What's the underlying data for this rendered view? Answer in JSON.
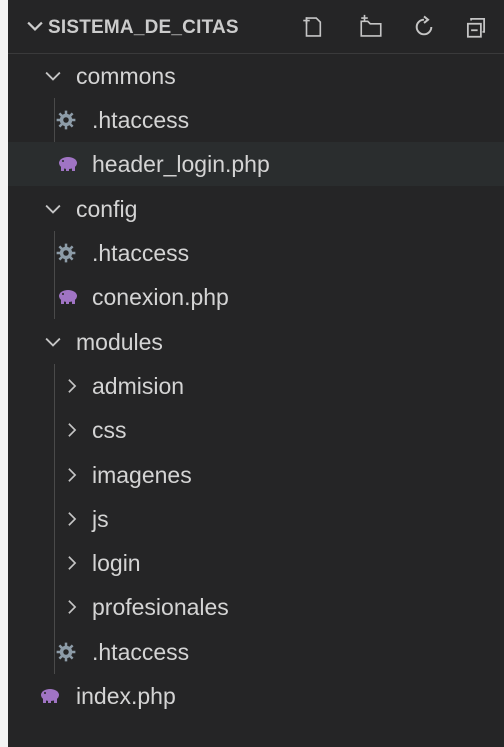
{
  "explorer": {
    "title": "SISTEMA_DE_CITAS",
    "header_icons": [
      "new-file-icon",
      "new-folder-icon",
      "refresh-icon",
      "collapse-all-icon"
    ],
    "tree": [
      {
        "label": "commons",
        "type": "folder",
        "expanded": true
      },
      {
        "label": ".htaccess",
        "type": "file",
        "icon": "gear-icon"
      },
      {
        "label": "header_login.php",
        "type": "file",
        "icon": "php-elephant-icon",
        "hovered": true
      },
      {
        "label": "config",
        "type": "folder",
        "expanded": true
      },
      {
        "label": ".htaccess",
        "type": "file",
        "icon": "gear-icon"
      },
      {
        "label": "conexion.php",
        "type": "file",
        "icon": "php-elephant-icon"
      },
      {
        "label": "modules",
        "type": "folder",
        "expanded": true
      },
      {
        "label": "admision",
        "type": "folder",
        "expanded": false
      },
      {
        "label": "css",
        "type": "folder",
        "expanded": false
      },
      {
        "label": "imagenes",
        "type": "folder",
        "expanded": false
      },
      {
        "label": "js",
        "type": "folder",
        "expanded": false
      },
      {
        "label": "login",
        "type": "folder",
        "expanded": false
      },
      {
        "label": "profesionales",
        "type": "folder",
        "expanded": false
      },
      {
        "label": ".htaccess",
        "type": "file",
        "icon": "gear-icon"
      },
      {
        "label": "index.php",
        "type": "file",
        "icon": "php-elephant-icon"
      }
    ]
  },
  "colors": {
    "background": "#252526",
    "text": "#d4d4d4",
    "php_icon": "#a074c4",
    "gear_icon": "#8d9ca8"
  }
}
